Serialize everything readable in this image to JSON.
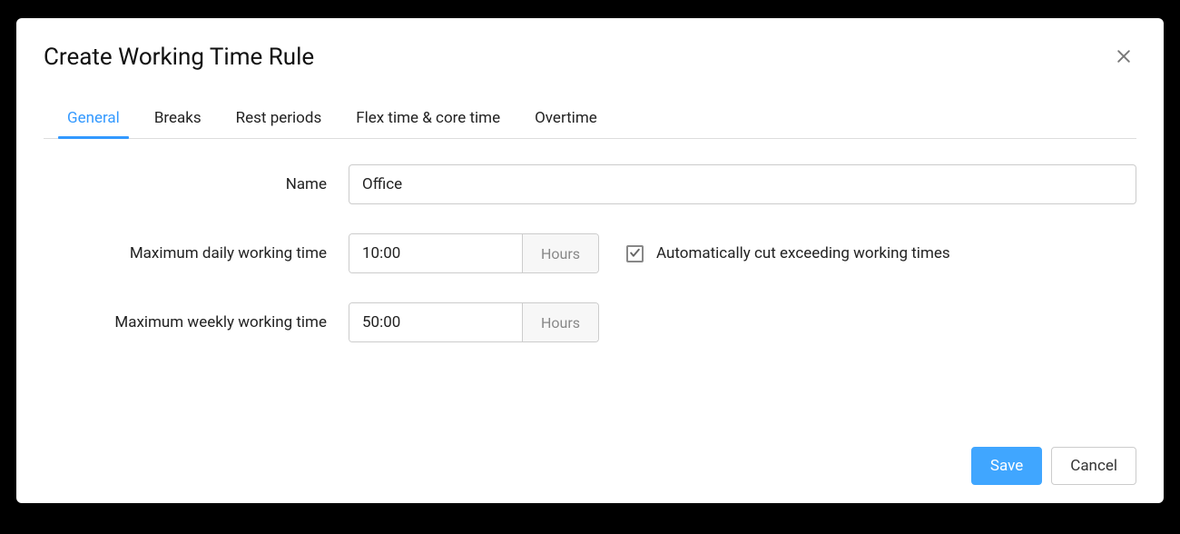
{
  "modal": {
    "title": "Create Working Time Rule"
  },
  "tabs": [
    {
      "label": "General",
      "active": true
    },
    {
      "label": "Breaks",
      "active": false
    },
    {
      "label": "Rest periods",
      "active": false
    },
    {
      "label": "Flex time & core time",
      "active": false
    },
    {
      "label": "Overtime",
      "active": false
    }
  ],
  "form": {
    "name": {
      "label": "Name",
      "value": "Office"
    },
    "maxDaily": {
      "label": "Maximum daily working time",
      "value": "10:00",
      "unit": "Hours"
    },
    "autoCut": {
      "checked": true,
      "label": "Automatically cut exceeding working times"
    },
    "maxWeekly": {
      "label": "Maximum weekly working time",
      "value": "50:00",
      "unit": "Hours"
    }
  },
  "footer": {
    "save": "Save",
    "cancel": "Cancel"
  }
}
